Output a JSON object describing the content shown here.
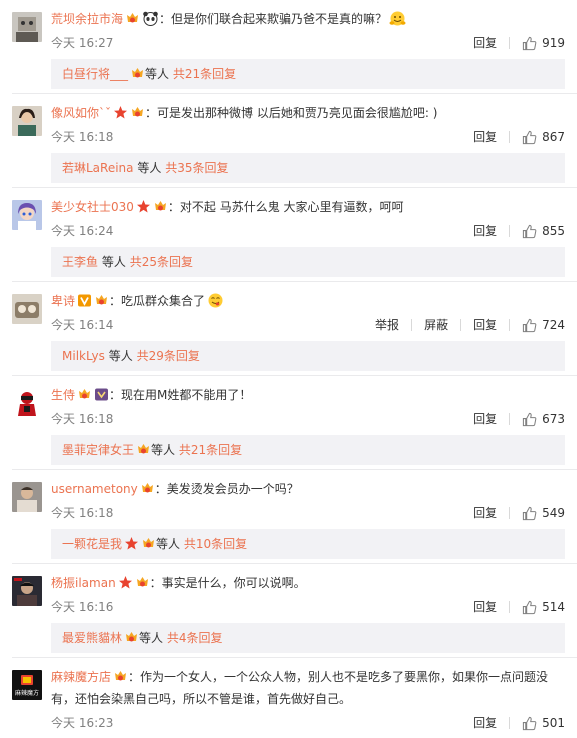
{
  "action_labels": {
    "reply": "回复",
    "report": "举报",
    "block": "屏蔽"
  },
  "reply_mid_text": "等人",
  "comments": [
    {
      "user": "荒坝余拉市海",
      "badges": [
        "vip"
      ],
      "text": "：但是你们联合起来欺骗乃爸不是真的嘛？",
      "text_emoji_before": "panda",
      "text_emoji_after": "hug",
      "time": "今天 16:27",
      "likes": "919",
      "reply_user": "白昼行将___",
      "reply_badges": [
        "vip"
      ],
      "reply_count": "共21条回复"
    },
    {
      "user": "像风如你`ˇ",
      "badges": [
        "star",
        "vip"
      ],
      "text": "：可是发出那种微博 以后她和贾乃亮见面会很尴尬吧: )",
      "time": "今天 16:18",
      "likes": "867",
      "reply_user": "若琳LaReina",
      "reply_badges": [],
      "reply_count": "共35条回复"
    },
    {
      "user": "美少女社士030",
      "badges": [
        "star",
        "vip"
      ],
      "text": "：对不起 马苏什么鬼 大家心里有逼数，呵呵",
      "time": "今天 16:24",
      "likes": "855",
      "reply_user": "王李鱼",
      "reply_badges": [],
      "reply_count": "共25条回复"
    },
    {
      "user": "卑诗",
      "badges": [
        "v",
        "vip"
      ],
      "text": "：吃瓜群众集合了",
      "text_emoji_after": "yum",
      "time": "今天 16:14",
      "likes": "724",
      "has_extra": true,
      "reply_user": "MilkLys",
      "reply_badges": [],
      "reply_count": "共29条回复"
    },
    {
      "user": "生侍",
      "badges": [
        "vip",
        "member"
      ],
      "text": "：现在用M姓都不能用了！",
      "time": "今天 16:18",
      "likes": "673",
      "reply_user": "墨菲定律女王",
      "reply_badges": [
        "vip"
      ],
      "reply_count": "共21条回复"
    },
    {
      "user": "usernametony",
      "badges": [
        "vip"
      ],
      "text": "：美发烫发会员办一个吗？",
      "time": "今天 16:18",
      "likes": "549",
      "reply_user": "一颗花是我",
      "reply_badges": [
        "star",
        "vip"
      ],
      "reply_count": "共10条回复"
    },
    {
      "user": "杨振ilaman",
      "badges": [
        "star",
        "vip"
      ],
      "text": "：事实是什么，你可以说啊。",
      "time": "今天 16:16",
      "likes": "514",
      "reply_user": "最爱熊貓林",
      "reply_badges": [
        "vip"
      ],
      "reply_count": "共4条回复"
    },
    {
      "user": "麻辣魔方店",
      "badges": [
        "vip"
      ],
      "text": "：作为一个女人，一个公众人物，别人也不是吃多了要黑你，如果你一点问题没有，还怕会染黑自己吗，所以不管是谁，首先做好自己。",
      "time": "今天 16:23",
      "likes": "501",
      "avatar_text": "麻辣魔方"
    }
  ],
  "colors": {
    "username": "#eb7350",
    "reply_bg": "#f2f2f5",
    "meta": "#808080",
    "divider": "#eaeaec"
  }
}
